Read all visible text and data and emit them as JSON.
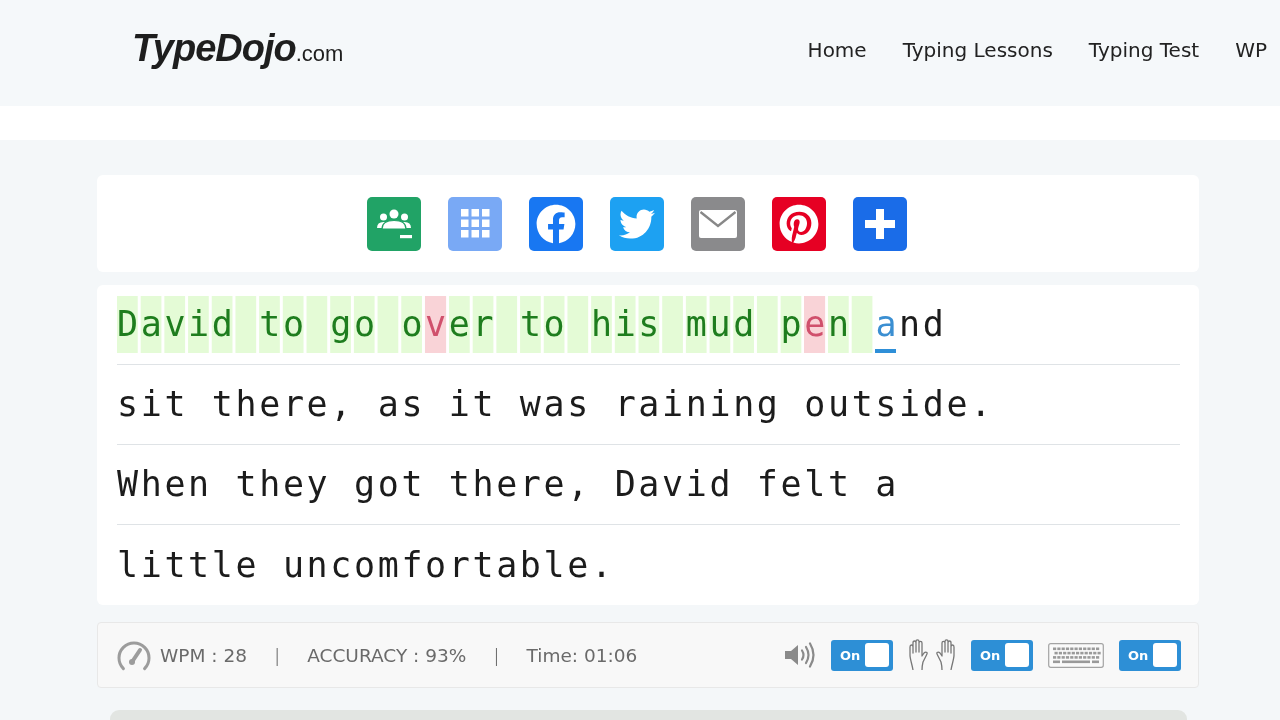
{
  "header": {
    "logo": {
      "name": "TypeDojo",
      "suffix": ".com"
    },
    "nav": [
      {
        "label": "Home"
      },
      {
        "label": "Typing Lessons"
      },
      {
        "label": "Typing Test"
      },
      {
        "label": "WP"
      }
    ]
  },
  "typing": {
    "lines": [
      {
        "segments": [
          {
            "text": "David to go o",
            "kind": "correct"
          },
          {
            "text": "v",
            "kind": "wrong"
          },
          {
            "text": "er to his mud p",
            "kind": "correct"
          },
          {
            "text": "e",
            "kind": "wrong"
          },
          {
            "text": "n ",
            "kind": "correct"
          },
          {
            "text": "a",
            "kind": "current"
          },
          {
            "text": "nd",
            "kind": "pending"
          }
        ]
      },
      {
        "segments": [
          {
            "text": "sit there, as it was raining outside.",
            "kind": "pending"
          }
        ]
      },
      {
        "segments": [
          {
            "text": "When they got there, David felt a",
            "kind": "pending"
          }
        ]
      },
      {
        "segments": [
          {
            "text": "little uncomfortable.",
            "kind": "pending"
          }
        ]
      }
    ]
  },
  "status": {
    "items": [
      {
        "kind": "stat",
        "text": "WPM : 28"
      },
      {
        "kind": "divider",
        "text": "|"
      },
      {
        "kind": "stat",
        "text": "ACCURACY : 93%"
      },
      {
        "kind": "divider",
        "text": "|"
      },
      {
        "kind": "stat",
        "text": "Time: 01:06"
      }
    ],
    "toggles": [
      {
        "label": "On",
        "on": true
      },
      {
        "label": "On",
        "on": true
      },
      {
        "label": "On",
        "on": true
      }
    ]
  }
}
